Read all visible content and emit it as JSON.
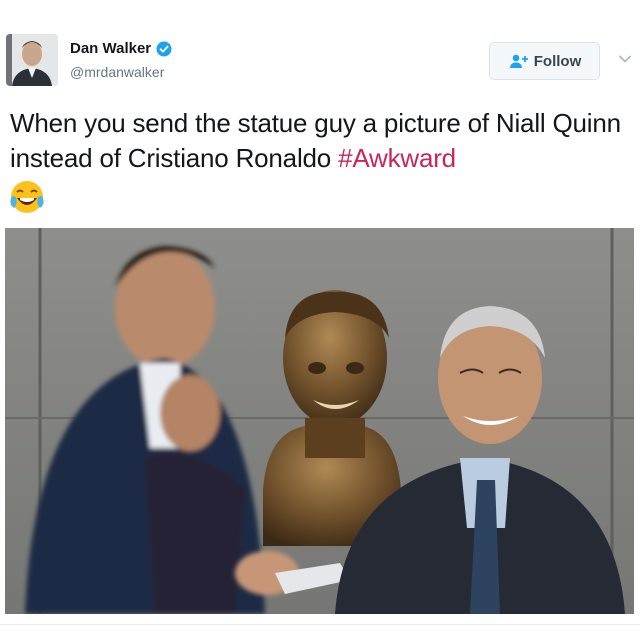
{
  "author": {
    "display_name": "Dan Walker",
    "handle": "@mrdanwalker",
    "verified": true,
    "avatar_icon": "profile-photo"
  },
  "follow_button": {
    "label": "Follow",
    "icon": "add-user-icon"
  },
  "menu_icon": "chevron-down-icon",
  "tweet": {
    "text": "When you send the statue guy a picture of Niall Quinn instead of Cristiano Ronaldo",
    "hashtag": "#Awkward",
    "emoji": "face-with-tears-of-joy"
  },
  "colors": {
    "hashtag": "#c8265c",
    "verified": "#1da1f2",
    "handle": "#657786"
  }
}
